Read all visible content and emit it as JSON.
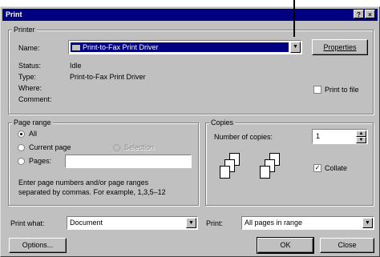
{
  "dialog": {
    "title": "Print",
    "help_glyph": "?",
    "close_glyph": "×"
  },
  "printer": {
    "group_label": "Printer",
    "name_label": "Name:",
    "name_value": "Print-to-Fax Print Driver",
    "status_label": "Status:",
    "status_value": "Idle",
    "type_label": "Type:",
    "type_value": "Print-to-Fax Print Driver",
    "where_label": "Where:",
    "where_value": "",
    "comment_label": "Comment:",
    "comment_value": "",
    "properties_button": "Properties",
    "print_to_file_label": "Print to file",
    "print_to_file_checked": false
  },
  "page_range": {
    "group_label": "Page range",
    "all_label": "All",
    "current_page_label": "Current page",
    "selection_label": "Selection",
    "pages_label": "Pages:",
    "pages_value": "",
    "selected": "all",
    "help_text_line1": "Enter page numbers and/or page ranges",
    "help_text_line2": "separated by commas.  For example, 1,3,5–12"
  },
  "copies": {
    "group_label": "Copies",
    "number_label": "Number of copies:",
    "number_value": "1",
    "collate_label": "Collate",
    "collate_checked": true
  },
  "bottom": {
    "print_what_label": "Print what:",
    "print_what_value": "Document",
    "print_label": "Print:",
    "print_value": "All pages in range",
    "options_button": "Options...",
    "ok_button": "OK",
    "close_button": "Close"
  },
  "icons": {
    "dropdown": "▼",
    "spin_up": "▲",
    "spin_down": "▼",
    "check": "✓"
  }
}
